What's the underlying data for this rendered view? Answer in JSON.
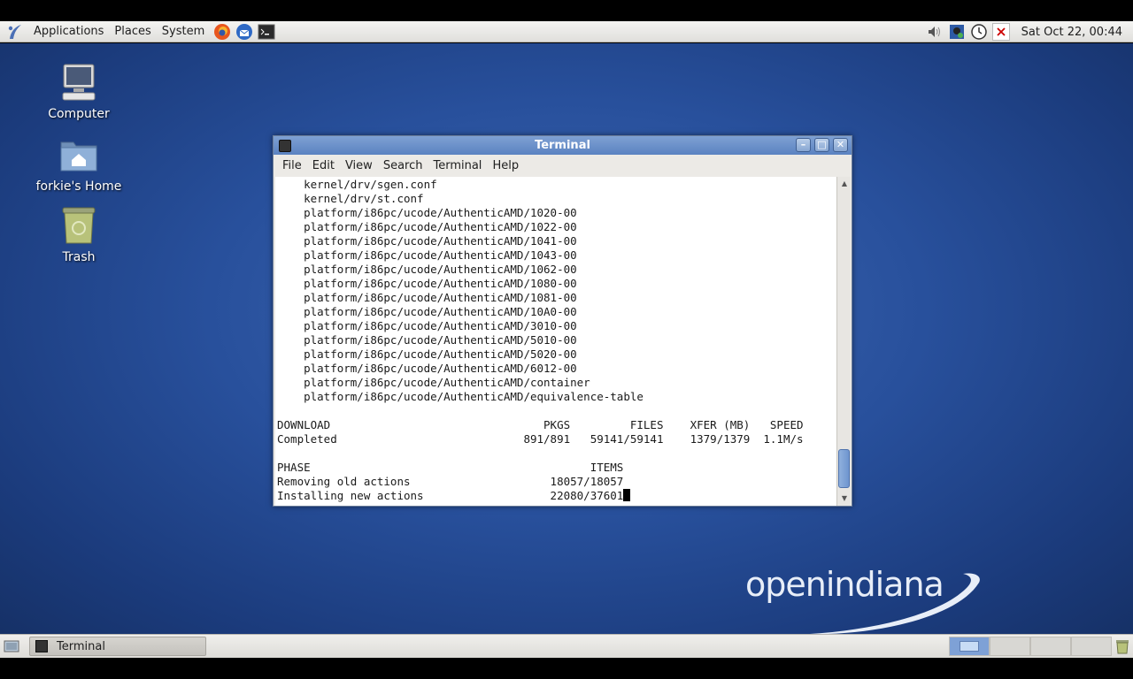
{
  "top_panel": {
    "menus": [
      "Applications",
      "Places",
      "System"
    ],
    "launchers": [
      "firefox-icon",
      "thunderbird-icon",
      "terminal-launcher-icon"
    ],
    "tray": [
      "volume-icon",
      "network-icon",
      "update-icon",
      "close-icon"
    ],
    "clock": "Sat Oct 22, 00:44"
  },
  "desktop": {
    "icons": [
      {
        "label": "Computer",
        "icon": "computer-icon"
      },
      {
        "label": "forkie's Home",
        "icon": "home-folder-icon"
      },
      {
        "label": "Trash",
        "icon": "trash-icon"
      }
    ],
    "logo_text": "openindiana"
  },
  "terminal": {
    "title": "Terminal",
    "menus": [
      "File",
      "Edit",
      "View",
      "Search",
      "Terminal",
      "Help"
    ],
    "lines": [
      "    kernel/drv/sgen.conf",
      "    kernel/drv/st.conf",
      "    platform/i86pc/ucode/AuthenticAMD/1020-00",
      "    platform/i86pc/ucode/AuthenticAMD/1022-00",
      "    platform/i86pc/ucode/AuthenticAMD/1041-00",
      "    platform/i86pc/ucode/AuthenticAMD/1043-00",
      "    platform/i86pc/ucode/AuthenticAMD/1062-00",
      "    platform/i86pc/ucode/AuthenticAMD/1080-00",
      "    platform/i86pc/ucode/AuthenticAMD/1081-00",
      "    platform/i86pc/ucode/AuthenticAMD/10A0-00",
      "    platform/i86pc/ucode/AuthenticAMD/3010-00",
      "    platform/i86pc/ucode/AuthenticAMD/5010-00",
      "    platform/i86pc/ucode/AuthenticAMD/5020-00",
      "    platform/i86pc/ucode/AuthenticAMD/6012-00",
      "    platform/i86pc/ucode/AuthenticAMD/container",
      "    platform/i86pc/ucode/AuthenticAMD/equivalence-table",
      "",
      "DOWNLOAD                                PKGS         FILES    XFER (MB)   SPEED",
      "Completed                            891/891   59141/59141    1379/1379  1.1M/s",
      "",
      "PHASE                                          ITEMS",
      "Removing old actions                     18057/18057",
      "Installing new actions                   22080/37601"
    ]
  },
  "taskbar": {
    "task_label": "Terminal",
    "workspaces": 4,
    "active_workspace": 1
  }
}
